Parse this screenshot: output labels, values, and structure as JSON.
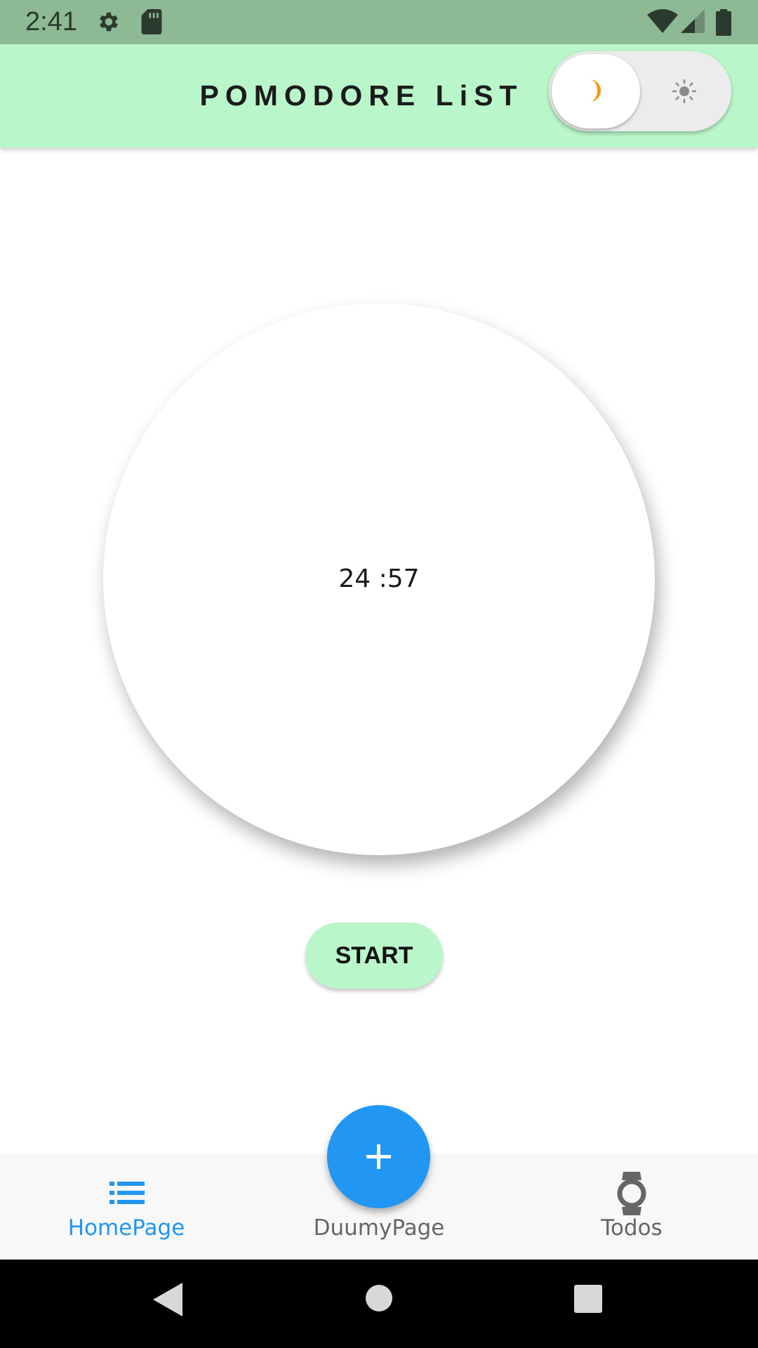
{
  "status_bar": {
    "time": "2:41",
    "icons": [
      "settings-gear-icon",
      "sd-card-icon",
      "wifi-icon",
      "cell-signal-icon",
      "battery-icon"
    ]
  },
  "app_bar": {
    "title": "POMODORE LiST",
    "background": "#b9f6ca",
    "theme_toggle": {
      "selected": "dark",
      "left_icon": "moon-icon",
      "right_icon": "sun-icon",
      "moon_color": "#f59a0b"
    }
  },
  "timer": {
    "display": "24 :57"
  },
  "start_button": {
    "label": "START",
    "background": "#b9f6ca"
  },
  "fab": {
    "icon": "plus-icon",
    "color": "#2196f3"
  },
  "bottom_nav": {
    "active_color": "#2196f3",
    "inactive_color": "#666666",
    "items": [
      {
        "label": "HomePage",
        "icon": "list-icon",
        "active": true
      },
      {
        "label": "DuumyPage",
        "icon": "",
        "active": false
      },
      {
        "label": "Todos",
        "icon": "watch-icon",
        "active": false
      }
    ]
  },
  "system_nav": {
    "buttons": [
      "back-icon",
      "home-icon",
      "recents-icon"
    ]
  }
}
